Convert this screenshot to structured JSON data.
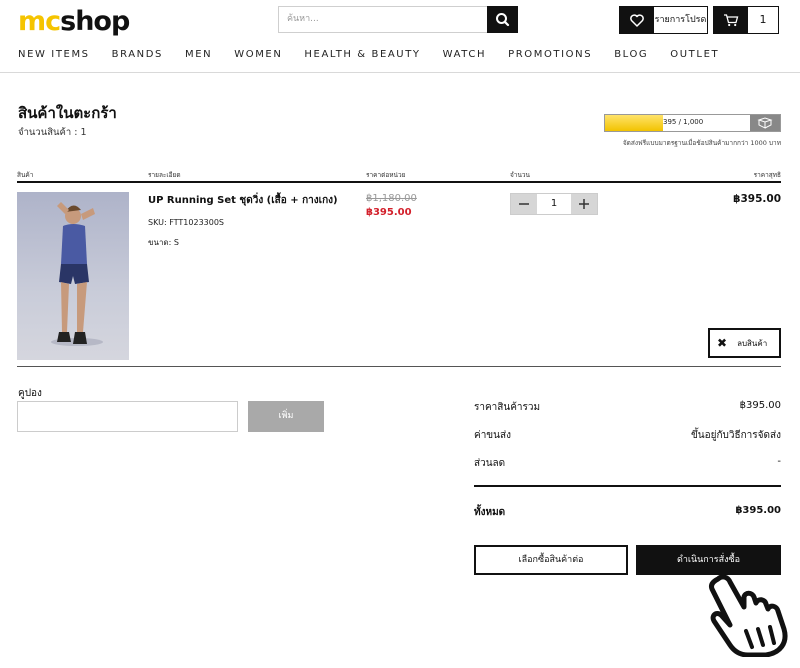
{
  "header": {
    "logo_mc": "mc",
    "logo_shop": "shop",
    "search_placeholder": "ค้นหา...",
    "wishlist_label": "รายการโปรด",
    "cart_count": "1"
  },
  "nav": [
    "NEW ITEMS",
    "BRANDS",
    "MEN",
    "WOMEN",
    "HEALTH & BEAUTY",
    "WATCH",
    "PROMOTIONS",
    "BLOG",
    "OUTLET"
  ],
  "cart": {
    "title": "สินค้าในตะกร้า",
    "count_label": "จำนวนสินค้า : 1",
    "shipping_progress": {
      "current": 395,
      "target": 1000,
      "text": "395 / 1,000"
    },
    "shipping_note": "จัดส่งฟรีแบบมาตรฐานเมื่อช้อปสินค้ามากกว่า 1000 บาท"
  },
  "table": {
    "headers": [
      "สินค้า",
      "รายละเอียด",
      "ราคาต่อหน่วย",
      "จำนวน",
      "ราคาสุทธิ"
    ]
  },
  "item": {
    "name": "UP Running Set ชุดวิ่ง (เสื้อ + กางเกง)",
    "sku": "SKU: FTT1023300S",
    "size": "ขนาด: S",
    "price_old": "฿1,180.00",
    "price_new": "฿395.00",
    "quantity": "1",
    "line_total": "฿395.00",
    "remove_label": "ลบสินค้า"
  },
  "coupon": {
    "label": "คูปอง",
    "button": "เพิ่ม"
  },
  "summary": {
    "subtotal_label": "ราคาสินค้ารวม",
    "subtotal_value": "฿395.00",
    "shipping_label": "ค่าขนส่ง",
    "shipping_value": "ขึ้นอยู่กับวิธีการจัดส่ง",
    "discount_label": "ส่วนลด",
    "discount_value": "-",
    "total_label": "ทั้งหมด",
    "total_value": "฿395.00"
  },
  "actions": {
    "continue_label": "เลือกซื้อสินค้าต่อ",
    "checkout_label": "ดำเนินการสั่งซื้อ"
  },
  "colors": {
    "brand_yellow": "#f5c400",
    "sale_red": "#d3202b",
    "dark": "#111111"
  }
}
